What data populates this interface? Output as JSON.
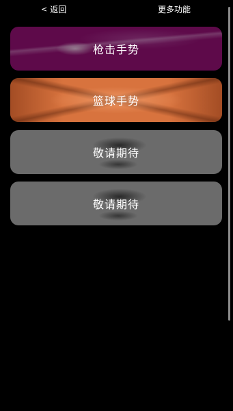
{
  "topbar": {
    "back_icon": "<",
    "back_label": "返回",
    "more_label": "更多功能"
  },
  "cards": [
    {
      "label": "枪击手势",
      "color": "#5e0a4a"
    },
    {
      "label": "篮球手势",
      "color": "#d8733e"
    },
    {
      "label": "敬请期待",
      "color": "#6b6b6b"
    },
    {
      "label": "敬请期待",
      "color": "#6b6b6b"
    }
  ]
}
